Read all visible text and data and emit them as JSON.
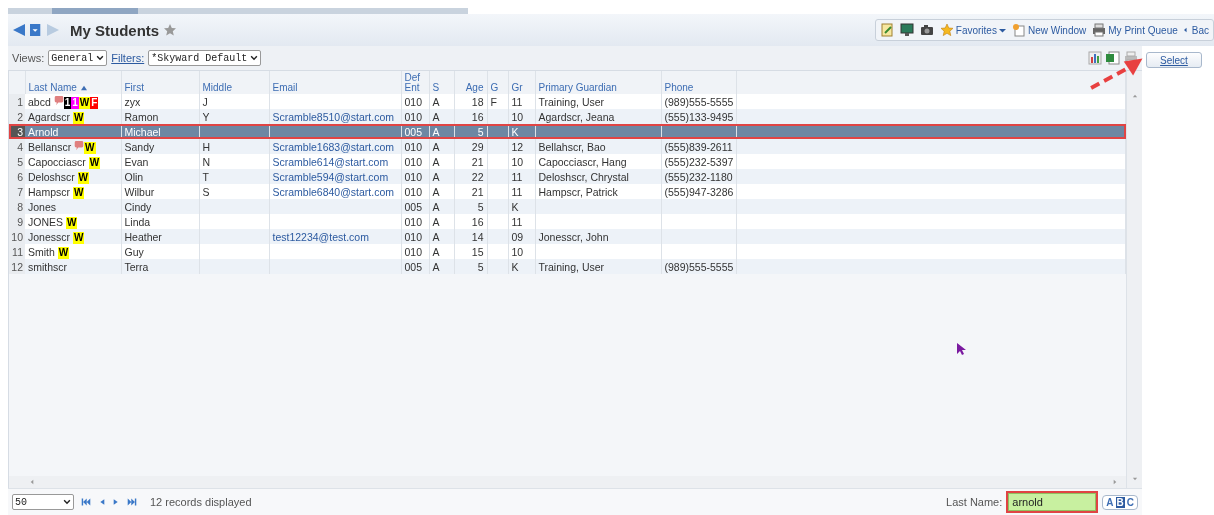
{
  "title": "My Students",
  "toolbar": [
    {
      "kind": "icon"
    },
    {
      "kind": "icon"
    },
    {
      "kind": "icon"
    },
    {
      "kind": "link",
      "label": "Favorites",
      "dropdown": true
    },
    {
      "kind": "link",
      "label": "New Window",
      "dropdown": false
    },
    {
      "kind": "link",
      "label": "My Print Queue",
      "dropdown": false
    },
    {
      "kind": "link",
      "label": "Bac",
      "dropdown": false
    }
  ],
  "views": {
    "label": "Views:",
    "value": "General"
  },
  "filters": {
    "label": "Filters:",
    "value": "*Skyward Default"
  },
  "select_button": {
    "label": "Select",
    "pointer_arrow": true
  },
  "columns": [
    {
      "label": "Last Name",
      "sorted": true
    },
    {
      "label": "First",
      "sorted": false
    },
    {
      "label": "Middle",
      "sorted": false
    },
    {
      "label": "Email",
      "sorted": false
    },
    {
      "label": "Def Ent",
      "sorted": false
    },
    {
      "label": "S",
      "sorted": false
    },
    {
      "label": "Age",
      "sorted": false
    },
    {
      "label": "G",
      "sorted": false
    },
    {
      "label": "Gr",
      "sorted": false
    },
    {
      "label": "Primary Guardian",
      "sorted": false
    },
    {
      "label": "Phone",
      "sorted": false
    }
  ],
  "rows": [
    {
      "num": "1",
      "selected": false,
      "outlined": false,
      "alert": true,
      "badges": [
        {
          "text": "1",
          "color": "#000000"
        },
        {
          "text": "1",
          "color": "#ff00ff"
        },
        {
          "text": "W",
          "color": "#ffff00"
        },
        {
          "text": "F",
          "color": "#ff0000"
        }
      ],
      "cells": [
        "abcd",
        "zyx",
        "J",
        "",
        "010",
        "A",
        "18",
        "F",
        "11",
        "Training, User",
        "(989)555-5555"
      ]
    },
    {
      "num": "2",
      "selected": false,
      "outlined": false,
      "alert": false,
      "badges": [
        {
          "text": "W",
          "color": "#ffff00"
        }
      ],
      "cells": [
        "Agardscr",
        "Ramon",
        "Y",
        "Scramble8510@start.com",
        "010",
        "A",
        "16",
        "",
        "10",
        "Agardscr, Jeana",
        "(555)133-9495"
      ]
    },
    {
      "num": "3",
      "selected": true,
      "outlined": true,
      "alert": false,
      "badges": [],
      "cells": [
        "Arnold",
        "Michael",
        "",
        "",
        "005",
        "A",
        "5",
        "",
        "K",
        "",
        ""
      ]
    },
    {
      "num": "4",
      "selected": false,
      "outlined": false,
      "alert": true,
      "badges": [
        {
          "text": "W",
          "color": "#ffff00"
        }
      ],
      "cells": [
        "Bellanscr",
        "Sandy",
        "H",
        "Scramble1683@start.com",
        "010",
        "A",
        "29",
        "",
        "12",
        "Bellahscr, Bao",
        "(555)839-2611"
      ]
    },
    {
      "num": "5",
      "selected": false,
      "outlined": false,
      "alert": false,
      "badges": [
        {
          "text": "W",
          "color": "#ffff00"
        }
      ],
      "cells": [
        "Capocciascr",
        "Evan",
        "N",
        "Scramble614@start.com",
        "010",
        "A",
        "21",
        "",
        "10",
        "Capocciascr, Hang",
        "(555)232-5397"
      ]
    },
    {
      "num": "6",
      "selected": false,
      "outlined": false,
      "alert": false,
      "badges": [
        {
          "text": "W",
          "color": "#ffff00"
        }
      ],
      "cells": [
        "Deloshscr",
        "Olin",
        "T",
        "Scramble594@start.com",
        "010",
        "A",
        "22",
        "",
        "11",
        "Deloshscr, Chrystal",
        "(555)232-1180"
      ]
    },
    {
      "num": "7",
      "selected": false,
      "outlined": false,
      "alert": false,
      "badges": [
        {
          "text": "W",
          "color": "#ffff00"
        }
      ],
      "cells": [
        "Hampscr",
        "Wilbur",
        "S",
        "Scramble6840@start.com",
        "010",
        "A",
        "21",
        "",
        "11",
        "Hampscr, Patrick",
        "(555)947-3286"
      ]
    },
    {
      "num": "8",
      "selected": false,
      "outlined": false,
      "alert": false,
      "badges": [],
      "cells": [
        "Jones",
        "Cindy",
        "",
        "",
        "005",
        "A",
        "5",
        "",
        "K",
        "",
        ""
      ]
    },
    {
      "num": "9",
      "selected": false,
      "outlined": false,
      "alert": false,
      "badges": [
        {
          "text": "W",
          "color": "#ffff00"
        }
      ],
      "cells": [
        "JONES",
        "Linda",
        "",
        "",
        "010",
        "A",
        "16",
        "",
        "11",
        "",
        ""
      ]
    },
    {
      "num": "10",
      "selected": false,
      "outlined": false,
      "alert": false,
      "badges": [
        {
          "text": "W",
          "color": "#ffff00"
        }
      ],
      "cells": [
        "Jonesscr",
        "Heather",
        "",
        "test12234@test.com",
        "010",
        "A",
        "14",
        "",
        "09",
        "Jonesscr, John",
        ""
      ]
    },
    {
      "num": "11",
      "selected": false,
      "outlined": false,
      "alert": false,
      "badges": [
        {
          "text": "W",
          "color": "#ffff00"
        }
      ],
      "cells": [
        "Smith",
        "Guy",
        "",
        "",
        "010",
        "A",
        "15",
        "",
        "10",
        "",
        ""
      ]
    },
    {
      "num": "12",
      "selected": false,
      "outlined": false,
      "alert": false,
      "badges": [],
      "cells": [
        "smithscr",
        "Terra",
        "",
        "",
        "005",
        "A",
        "5",
        "",
        "K",
        "Training, User",
        "(989)555-5555"
      ]
    }
  ],
  "footer": {
    "page_size": "50",
    "records": "12 records displayed",
    "search_label": "Last Name:",
    "search_value": "arnold",
    "search_outlined": true,
    "letters": [
      {
        "label": "A",
        "selected": false
      },
      {
        "label": "B",
        "selected": true
      },
      {
        "label": "C",
        "selected": false
      }
    ]
  }
}
